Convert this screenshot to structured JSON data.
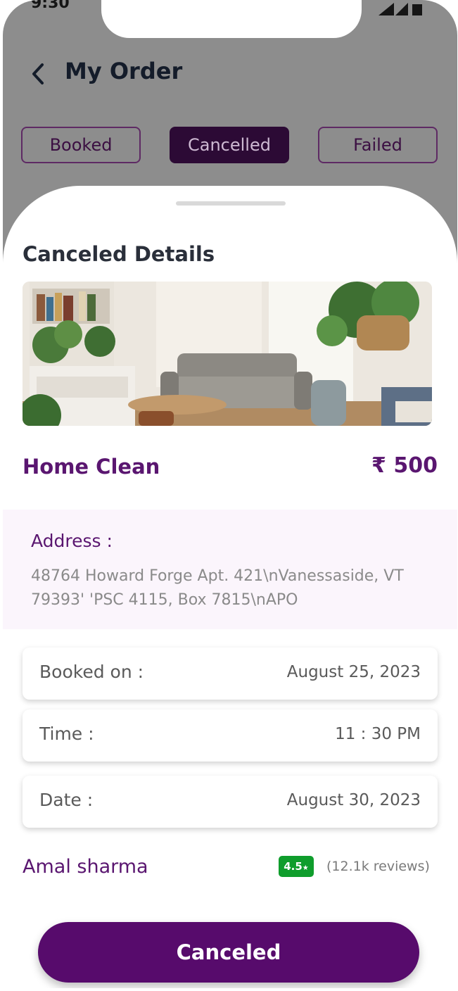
{
  "status_bar": {
    "time": "9:30"
  },
  "header": {
    "title": "My Order",
    "back_icon": "chevron-left-icon"
  },
  "tabs": [
    {
      "label": "Booked",
      "active": false
    },
    {
      "label": "Cancelled",
      "active": true
    },
    {
      "label": "Failed",
      "active": false
    }
  ],
  "sheet": {
    "title": "Canceled Details",
    "service": {
      "name": "Home Clean",
      "price": "₹ 500"
    },
    "address": {
      "label": "Address :",
      "text": "48764 Howard Forge Apt. 421\\nVanessaside, VT 79393' 'PSC 4115, Box 7815\\nAPO"
    },
    "details": [
      {
        "label": "Booked on :",
        "value": "August 25, 2023"
      },
      {
        "label": "Time :",
        "value": "11 : 30 PM"
      },
      {
        "label": "Date :",
        "value": "August 30, 2023"
      }
    ],
    "provider": {
      "name": "Amal sharma",
      "rating": "4.5",
      "rating_icon": "star-icon",
      "reviews": "(12.1k reviews)"
    },
    "action_button": "Canceled"
  },
  "colors": {
    "accent": "#570b6c",
    "tab_active": "#2c0a35",
    "rating_green": "#0f9d2c",
    "address_bg": "#fbf5fc"
  }
}
